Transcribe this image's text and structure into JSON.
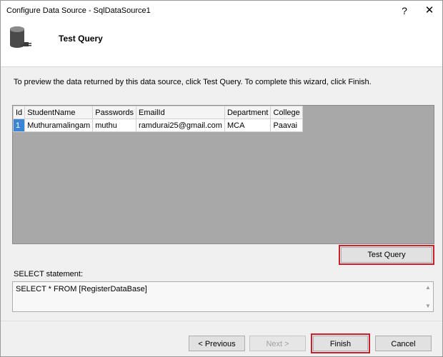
{
  "window": {
    "title": "Configure Data Source - SqlDataSource1",
    "help": "?",
    "close": "✕"
  },
  "header": {
    "title": "Test Query",
    "icon": "database-icon"
  },
  "instructions": "To preview the data returned by this data source, click Test Query. To complete this wizard, click Finish.",
  "grid": {
    "columns": [
      "Id",
      "StudentName",
      "Passwords",
      "EmailId",
      "Department",
      "College"
    ],
    "rows": [
      [
        "1",
        "Muthuramalingam",
        "muthu",
        "ramdurai25@gmail.com",
        "MCA",
        "Paavai"
      ]
    ]
  },
  "test_query_label": "Test Query",
  "select_label": "SELECT statement:",
  "sql": "SELECT * FROM [RegisterDataBase]",
  "scroll": {
    "up": "▲",
    "down": "▼"
  },
  "buttons": {
    "previous": "< Previous",
    "next": "Next >",
    "finish": "Finish",
    "cancel": "Cancel"
  },
  "colors": {
    "highlight": "#cc1f2b",
    "selected_cell": "#3a85d6",
    "grid_background": "#a8a8a8"
  }
}
